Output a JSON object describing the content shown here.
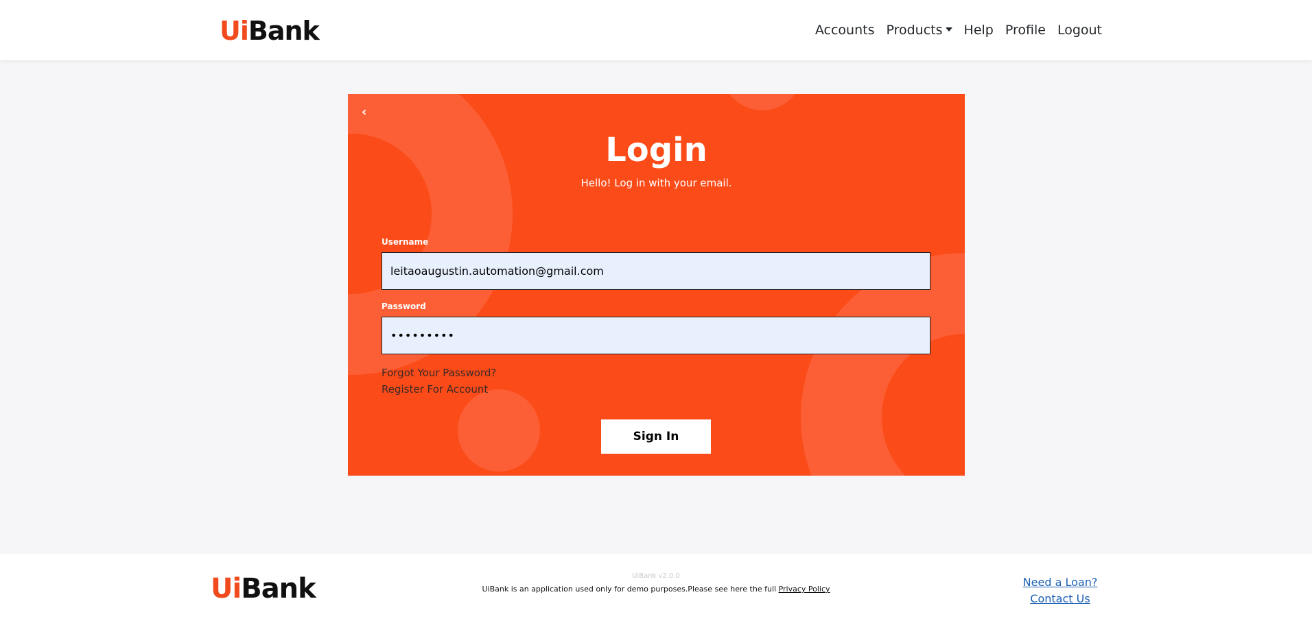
{
  "brand": {
    "ui": "Ui",
    "bank": "Bank",
    "accent_color": "#f04a1d",
    "card_color": "#fb4b19"
  },
  "nav": {
    "accounts": "Accounts",
    "products": "Products",
    "help": "Help",
    "profile": "Profile",
    "logout": "Logout"
  },
  "login": {
    "back_icon": "chevron-left-icon",
    "back_glyph": "‹",
    "title": "Login",
    "subtitle": "Hello! Log in with your email.",
    "username_label": "Username",
    "username_value": "leitaoaugustin.automation@gmail.com",
    "password_label": "Password",
    "password_value": "•••••••••",
    "forgot_link": "Forgot Your Password?",
    "register_link": "Register For Account",
    "signin_button": "Sign In"
  },
  "footer": {
    "version": "UiBank v2.0.0",
    "disclaimer": "UiBank is an application used only for demo purposes.Please see here the full ",
    "privacy_link": "Privacy Policy",
    "need_loan": "Need a Loan?",
    "contact_us": "Contact Us"
  }
}
